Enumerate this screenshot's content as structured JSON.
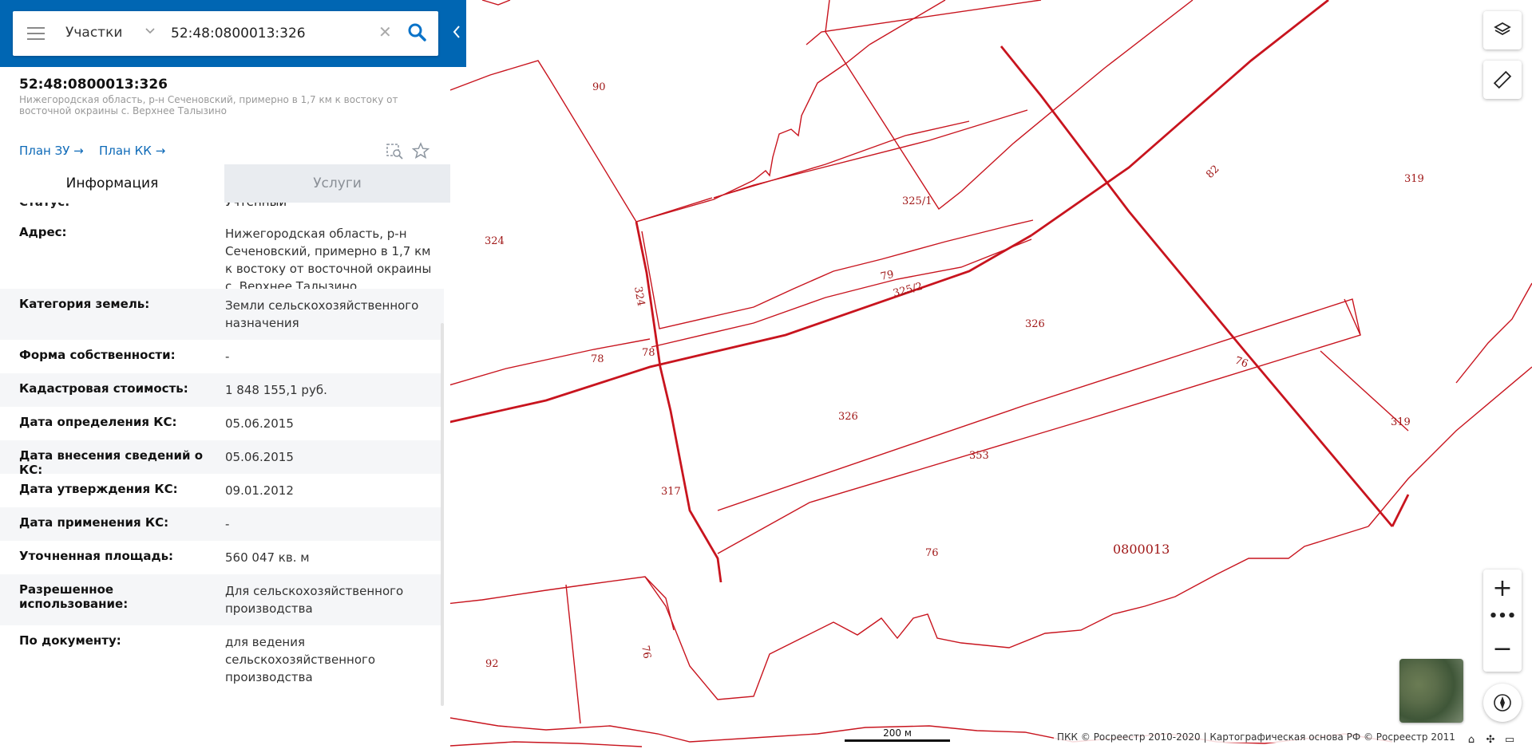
{
  "search": {
    "category": "Участки",
    "query": "52:48:0800013:326"
  },
  "object": {
    "cadastral_number": "52:48:0800013:326",
    "address_short": "Нижегородская область, р-н Сеченовский, примерно в 1,7 км к востоку от восточной окраины с. Верхнее Талызино",
    "plan_zu": "План ЗУ",
    "plan_kk": "План КК"
  },
  "tabs": {
    "info": "Информация",
    "services": "Услуги"
  },
  "partial_row": {
    "label": "Статус:",
    "value": "Учтенный"
  },
  "info_rows": [
    {
      "label": "Адрес:",
      "value": "Нижегородская область, р-н Сеченовский, примерно в 1,7 км к востоку от восточной окраины с. Верхнее Талызино"
    },
    {
      "label": "Категория земель:",
      "value": "Земли сельскохозяйственного назначения"
    },
    {
      "label": "Форма собственности:",
      "value": "-"
    },
    {
      "label": "Кадастровая стоимость:",
      "value": "1 848 155,1 руб."
    },
    {
      "label": "Дата определения КС:",
      "value": "05.06.2015"
    },
    {
      "label": "Дата внесения сведений о КС:",
      "value": "05.06.2015"
    },
    {
      "label": "Дата утверждения КС:",
      "value": "09.01.2012"
    },
    {
      "label": "Дата применения КС:",
      "value": "-"
    },
    {
      "label": "Уточненная площадь:",
      "value": "560 047 кв. м"
    },
    {
      "label": "Разрешенное использование:",
      "value": "Для сельскохозяйственного производства"
    },
    {
      "label": "По документу:",
      "value": "для ведения сельскохозяйственного производства"
    }
  ],
  "map": {
    "parcel_labels": [
      "90",
      "82",
      "319",
      "325/1",
      "324",
      "324",
      "79",
      "325/2",
      "326",
      "78",
      "78",
      "76",
      "326",
      "319",
      "353",
      "317",
      "76",
      "0800013",
      "92",
      "76"
    ],
    "scale_label": "200 м",
    "copyright": "ПКК © Росреестр 2010-2020 | Картографическая основа РФ © Росреестр 2011",
    "line_color": "#c8141e"
  },
  "colors": {
    "header_blue": "#0066b3",
    "link_blue": "#0e6ab8",
    "row_alt": "#f5f6f8"
  },
  "icons": {
    "menu": "hamburger-icon",
    "search": "search-icon",
    "clear": "close-icon",
    "layers": "layers-icon",
    "ruler": "ruler-icon",
    "zoom_in": "plus-icon",
    "zoom_out": "minus-icon",
    "compass": "compass-icon"
  }
}
